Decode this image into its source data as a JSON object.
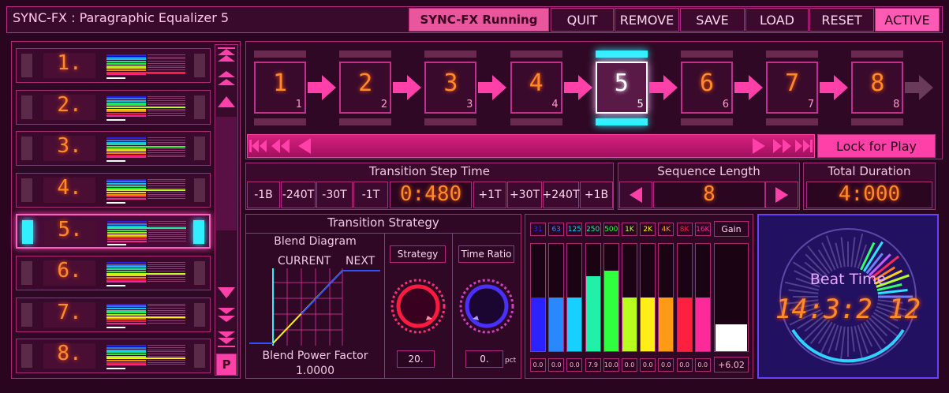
{
  "header": {
    "title": "SYNC-FX : Paragraphic Equalizer 5",
    "running_label": "SYNC-FX Running",
    "buttons": [
      "QUIT",
      "REMOVE",
      "SAVE",
      "LOAD",
      "RESET",
      "ACTIVE"
    ],
    "active_button": "ACTIVE"
  },
  "slots": {
    "items": [
      {
        "label": "1.",
        "bar_level": 0.12
      },
      {
        "label": "2.",
        "bar_level": 0.45
      },
      {
        "label": "3.",
        "bar_level": 0.6
      },
      {
        "label": "4.",
        "bar_level": 0.48
      },
      {
        "label": "5.",
        "bar_level": 0.65,
        "selected": true
      },
      {
        "label": "6.",
        "bar_level": 0.4
      },
      {
        "label": "7.",
        "bar_level": 0.35
      },
      {
        "label": "8.",
        "bar_level": 0.3
      }
    ],
    "selected_index": 4,
    "p_button": "P",
    "scroll_icons": [
      "skip-top-icon",
      "page-up-icon",
      "step-up-icon",
      "step-down-icon",
      "page-down-icon",
      "skip-bottom-icon"
    ]
  },
  "sequence": {
    "steps": [
      {
        "big": "1",
        "sub": "1"
      },
      {
        "big": "2",
        "sub": "2"
      },
      {
        "big": "3",
        "sub": "3"
      },
      {
        "big": "4",
        "sub": "4"
      },
      {
        "big": "5",
        "sub": "5"
      },
      {
        "big": "6",
        "sub": "6"
      },
      {
        "big": "7",
        "sub": "7"
      },
      {
        "big": "8",
        "sub": "8"
      }
    ],
    "current_index": 4,
    "lock_label": "Lock for Play"
  },
  "transition_step_time": {
    "title": "Transition Step Time",
    "value": "0:480",
    "minus_buttons": [
      "-1B",
      "-240T",
      "-30T",
      "-1T"
    ],
    "plus_buttons": [
      "+1T",
      "+30T",
      "+240T",
      "+1B"
    ]
  },
  "sequence_length": {
    "title": "Sequence Length",
    "value": "8"
  },
  "total_duration": {
    "title": "Total Duration",
    "value": "4:000"
  },
  "transition_strategy": {
    "title": "Transition Strategy",
    "blend_diagram_label": "Blend Diagram",
    "current_label": "CURRENT",
    "next_label": "NEXT",
    "blend_power_label": "Blend Power Factor",
    "blend_power_value": "1.0000",
    "strategy_label": "Strategy",
    "strategy_value": "20.",
    "time_ratio_label": "Time Ratio",
    "time_ratio_value": "0.",
    "time_ratio_unit": "pct"
  },
  "eq": {
    "bands": [
      {
        "label": "31",
        "value": "0.0",
        "level": 0.5,
        "color": "#2a22ff"
      },
      {
        "label": "63",
        "value": "0.0",
        "level": 0.5,
        "color": "#2a88ff"
      },
      {
        "label": "125",
        "value": "0.0",
        "level": 0.5,
        "color": "#18d0ff"
      },
      {
        "label": "250",
        "value": "7.9",
        "level": 0.7,
        "color": "#22f0a8"
      },
      {
        "label": "500",
        "value": "10.0",
        "level": 0.75,
        "color": "#30ff40"
      },
      {
        "label": "1K",
        "value": "0.0",
        "level": 0.5,
        "color": "#b8ff20"
      },
      {
        "label": "2K",
        "value": "0.0",
        "level": 0.5,
        "color": "#ffee18"
      },
      {
        "label": "4K",
        "value": "0.0",
        "level": 0.5,
        "color": "#ff9a14"
      },
      {
        "label": "8K",
        "value": "0.0",
        "level": 0.5,
        "color": "#ff2040"
      },
      {
        "label": "16K",
        "value": "0.0",
        "level": 0.5,
        "color": "#ff2a9a"
      }
    ],
    "gain_label": "Gain",
    "gain_value": "+6.02",
    "gain_level": 0.25
  },
  "beat": {
    "label": "Beat Time",
    "value": "14:3:2 12"
  },
  "colors": {
    "accent": "#ff2aa0",
    "cyan": "#30f0ff",
    "orange": "#ff8a2a",
    "panel": "#3a0a2c"
  }
}
